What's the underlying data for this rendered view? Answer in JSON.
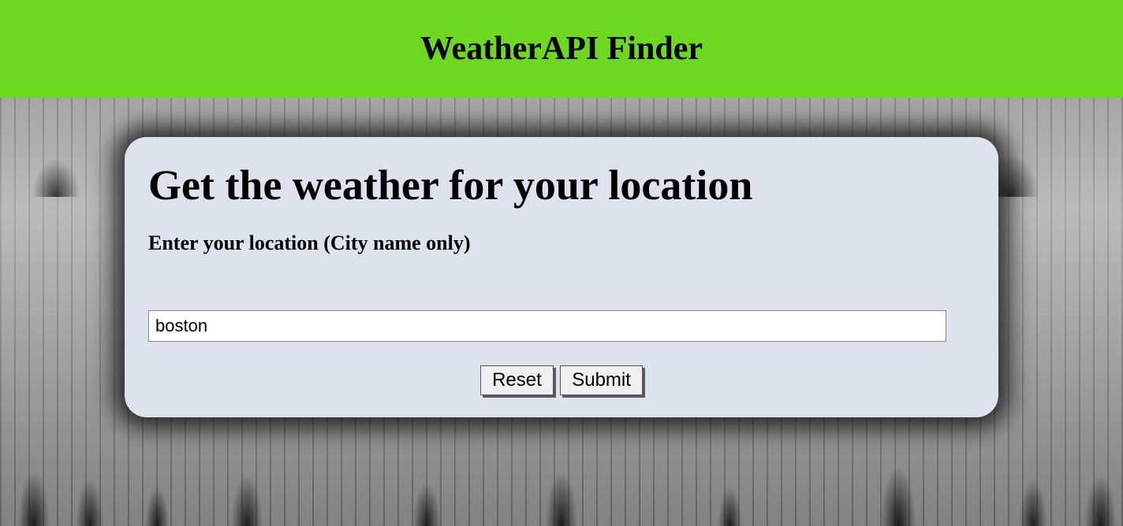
{
  "header": {
    "title": "WeatherAPI Finder"
  },
  "card": {
    "heading": "Get the weather for your location",
    "sub_heading": "Enter your location (City name only)",
    "location_value": "boston",
    "reset_label": "Reset",
    "submit_label": "Submit"
  }
}
